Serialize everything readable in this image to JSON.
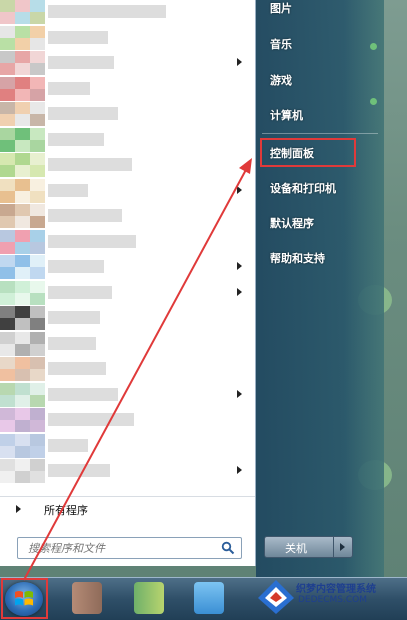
{
  "start_menu": {
    "all_programs_label": "所有程序",
    "search": {
      "placeholder": "搜索程序和文件",
      "icon": "search-icon"
    },
    "right_items": [
      {
        "label": "图片"
      },
      {
        "label": "音乐"
      },
      {
        "label": "游戏"
      },
      {
        "label": "计算机"
      },
      {
        "label": "控制面板",
        "highlighted": true
      },
      {
        "label": "设备和打印机"
      },
      {
        "label": "默认程序"
      },
      {
        "label": "帮助和支持"
      }
    ],
    "shutdown_label": "关机"
  },
  "taskbar": {
    "start_button_icon": "windows-logo-icon"
  },
  "watermark": {
    "name": "织梦内容管理系统",
    "site": "DEDECMS.COM"
  },
  "colors": {
    "highlight": "#e03a3a",
    "right_pane": "#285a6e",
    "taskbar": "#2f4f68"
  }
}
